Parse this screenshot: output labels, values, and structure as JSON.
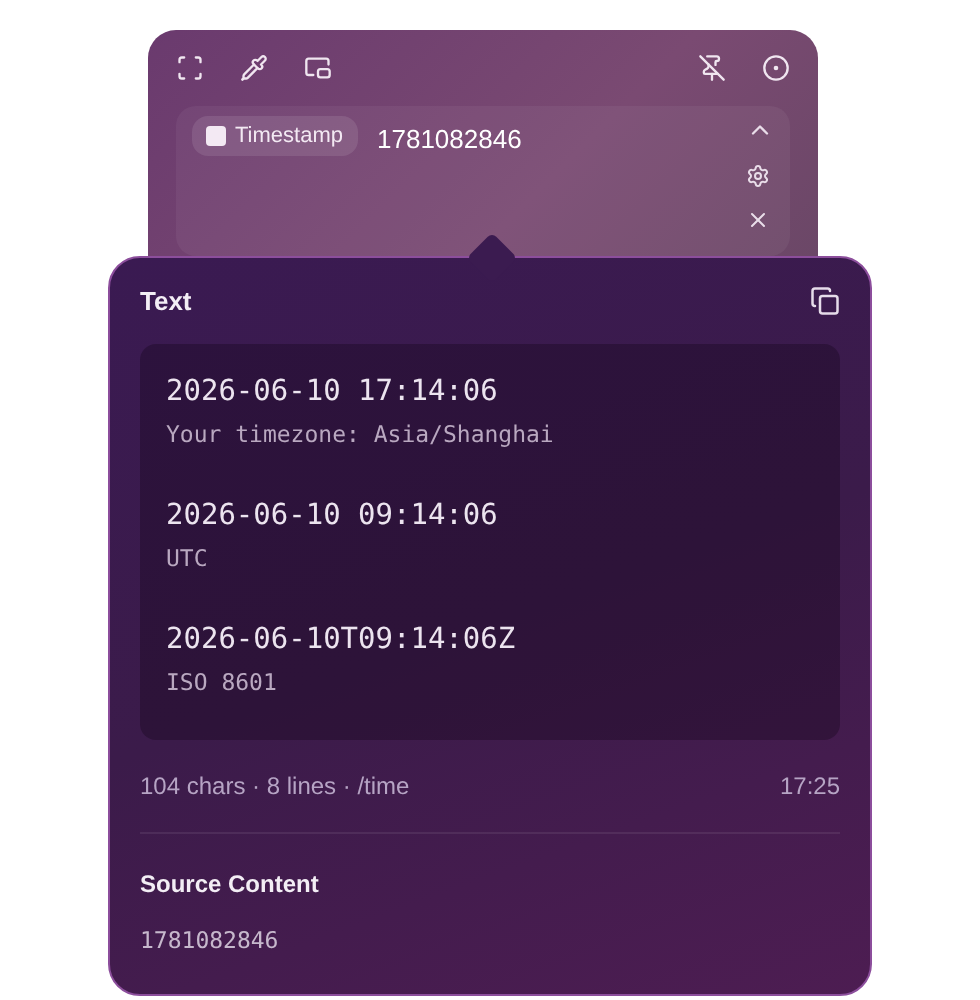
{
  "search_bar": {
    "tag": "Timestamp",
    "query": "1781082846"
  },
  "result": {
    "title": "Text",
    "entries": [
      {
        "value": "2026-06-10 17:14:06",
        "caption": "Your timezone: Asia/Shanghai"
      },
      {
        "value": "2026-06-10 09:14:06",
        "caption": "UTC"
      },
      {
        "value": "2026-06-10T09:14:06Z",
        "caption": "ISO 8601"
      }
    ],
    "stats": "104 chars · 8 lines · /time",
    "time": "17:25"
  },
  "source": {
    "title": "Source Content",
    "content": "1781082846"
  }
}
